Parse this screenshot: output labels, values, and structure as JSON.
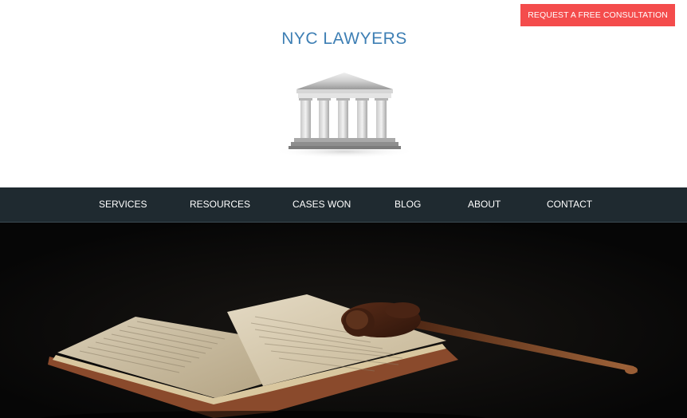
{
  "header": {
    "cta_label": "REQUEST A FREE CONSULTATION",
    "site_title": "NYC LAWYERS"
  },
  "logo": {
    "icon": "courthouse-icon"
  },
  "nav": {
    "items": [
      {
        "label": "SERVICES"
      },
      {
        "label": "RESOURCES"
      },
      {
        "label": "CASES WON"
      },
      {
        "label": "BLOG"
      },
      {
        "label": "ABOUT"
      },
      {
        "label": "CONTACT"
      }
    ]
  },
  "hero": {
    "image": "open-book-with-gavel"
  },
  "colors": {
    "cta_bg": "#f44c4c",
    "title": "#3e7fb4",
    "nav_bg": "#1f2a30",
    "hero_bg": "#0b0b0b"
  }
}
